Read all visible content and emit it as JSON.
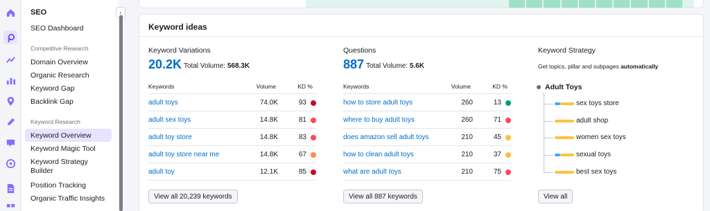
{
  "rail": {
    "icons": [
      "home-icon",
      "seo-icon",
      "trends-icon",
      "analytics-icon",
      "location-icon",
      "content-icon",
      "social-icon",
      "ads-icon",
      "reports-icon",
      "apps-icon"
    ]
  },
  "sidebar": {
    "title": "SEO",
    "dashboard": "SEO Dashboard",
    "sections": [
      {
        "title": "Competitive Research",
        "items": [
          "Domain Overview",
          "Organic Research",
          "Keyword Gap",
          "Backlink Gap"
        ]
      },
      {
        "title": "Keyword Research",
        "items": [
          "Keyword Overview",
          "Keyword Magic Tool",
          "Keyword Strategy Builder",
          "Position Tracking",
          "Organic Traffic Insights"
        ]
      }
    ],
    "active": "Keyword Overview",
    "collapse_glyph": "‹"
  },
  "card": {
    "title": "Keyword ideas",
    "variations": {
      "heading": "Keyword Variations",
      "count": "20.2K",
      "total_label": "Total Volume:",
      "total_value": "568.3K",
      "columns": [
        "Keywords",
        "Volume",
        "KD %"
      ],
      "rows": [
        {
          "keyword": "adult toys",
          "volume": "74.0K",
          "kd": "93",
          "color": "#d1002f"
        },
        {
          "keyword": "adult sex toys",
          "volume": "14.8K",
          "kd": "81",
          "color": "#ff4953"
        },
        {
          "keyword": "adult toy store",
          "volume": "14.8K",
          "kd": "83",
          "color": "#ff4953"
        },
        {
          "keyword": "adult toy store near me",
          "volume": "14.8K",
          "kd": "67",
          "color": "#ff8c43"
        },
        {
          "keyword": "adult toy",
          "volume": "12.1K",
          "kd": "85",
          "color": "#d1002f"
        }
      ],
      "view_all": "View all 20,239 keywords"
    },
    "questions": {
      "heading": "Questions",
      "count": "887",
      "total_label": "Total Volume:",
      "total_value": "5.6K",
      "columns": [
        "Keywords",
        "Volume",
        "KD %"
      ],
      "rows": [
        {
          "keyword": "how to store adult toys",
          "volume": "260",
          "kd": "13",
          "color": "#009f81"
        },
        {
          "keyword": "where to buy adult toys",
          "volume": "260",
          "kd": "71",
          "color": "#ff4953"
        },
        {
          "keyword": "does amazon sell adult toys",
          "volume": "210",
          "kd": "45",
          "color": "#fdc23c"
        },
        {
          "keyword": "how to clean adult toys",
          "volume": "210",
          "kd": "37",
          "color": "#fdc23c"
        },
        {
          "keyword": "what are adult toys",
          "volume": "210",
          "kd": "75",
          "color": "#ff4953"
        }
      ],
      "view_all": "View all 887 keywords"
    },
    "strategy": {
      "heading": "Keyword Strategy",
      "subtitle_prefix": "Get topics, pillar and subpages ",
      "subtitle_bold": "automatically",
      "root": "Adult Toys",
      "leaves": [
        {
          "label": "sex toys store",
          "colors": [
            "#45a5ff",
            "#fdc23c"
          ]
        },
        {
          "label": "adult shop",
          "colors": [
            "#fdc23c"
          ]
        },
        {
          "label": "women sex toys",
          "colors": [
            "#fdc23c"
          ]
        },
        {
          "label": "sexual toys",
          "colors": [
            "#45a5ff",
            "#fdc23c"
          ]
        },
        {
          "label": "best sex toys",
          "colors": [
            "#fdc23c"
          ]
        }
      ],
      "view_all": "View all"
    }
  }
}
